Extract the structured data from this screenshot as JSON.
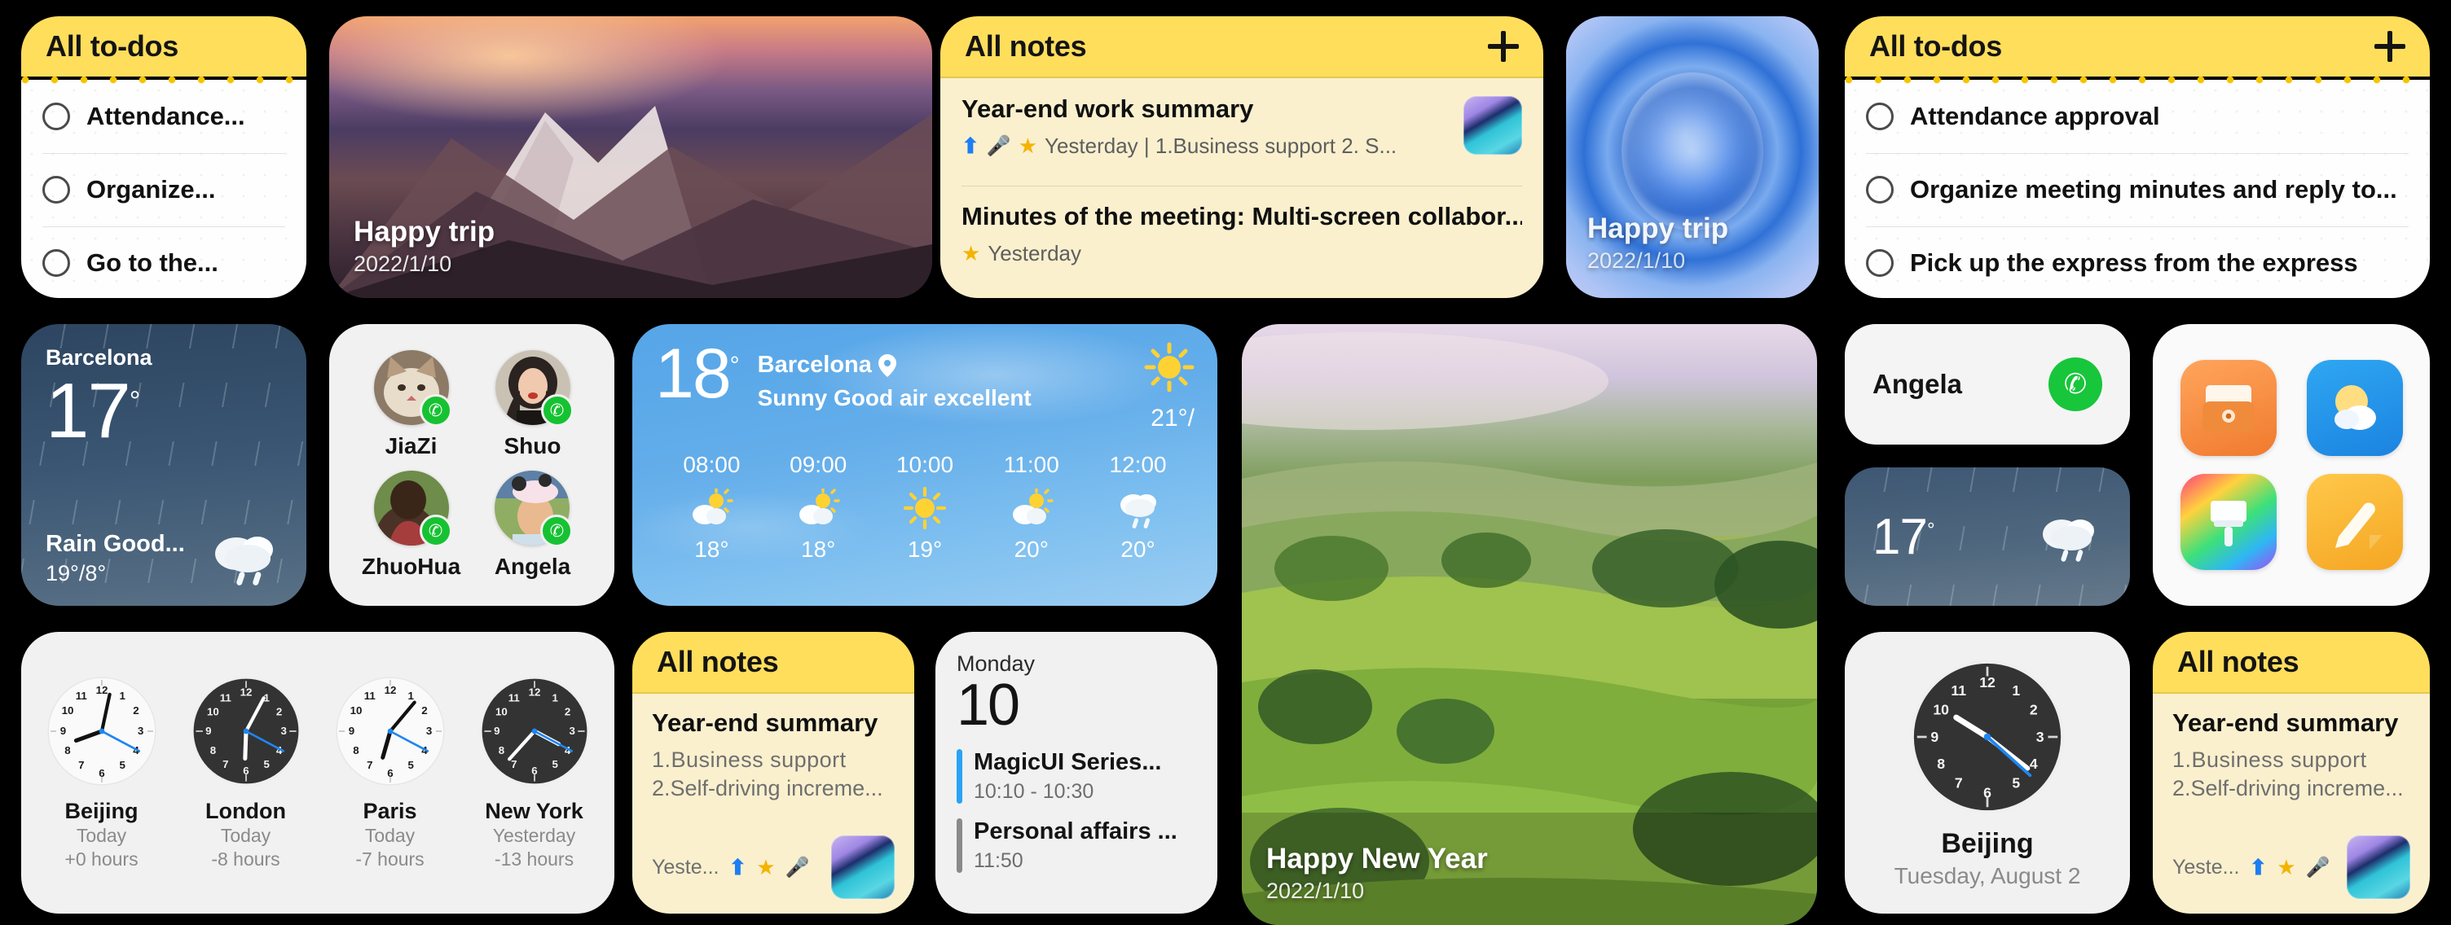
{
  "todo_small": {
    "title": "All to-dos",
    "items": [
      "Attendance...",
      "Organize...",
      "Go to the..."
    ]
  },
  "photo_trip": {
    "title": "Happy trip",
    "date": "2022/1/10"
  },
  "notes_wide": {
    "title": "All notes",
    "add_label": "+",
    "items": [
      {
        "title": "Year-end work summary",
        "meta": "Yesterday | 1.Business support  2. S...",
        "icons": [
          "up-icon",
          "mic-icon",
          "star-icon"
        ],
        "has_thumb": true
      },
      {
        "title": "Minutes of the meeting: Multi-screen collabor...",
        "meta": "Yesterday",
        "icons": [
          "star-icon"
        ],
        "has_thumb": false
      }
    ]
  },
  "photo_drop": {
    "title": "Happy trip",
    "date": "2022/1/10"
  },
  "todo_wide": {
    "title": "All to-dos",
    "add_label": "+",
    "items": [
      "Attendance approval",
      "Organize meeting minutes and reply to...",
      "Pick up the express from the express"
    ]
  },
  "weather_dark": {
    "city": "Barcelona",
    "temp": "17",
    "degree": "°",
    "condition": "Rain  Good...",
    "range": "19°/8°",
    "icon": "rain-cloud-icon"
  },
  "contacts": {
    "people": [
      {
        "name": "JiaZi",
        "avatar": "cat-avatar"
      },
      {
        "name": "Shuo",
        "avatar": "woman-avatar"
      },
      {
        "name": "ZhuoHua",
        "avatar": "woman-back-avatar"
      },
      {
        "name": "Angela",
        "avatar": "woman-hat-avatar"
      }
    ],
    "call_icon": "phone-icon"
  },
  "weather_blue": {
    "temp": "18",
    "degree": "°",
    "city": "Barcelona",
    "location_icon": "location-pin-icon",
    "condition": "Sunny  Good air excellent",
    "high": "21°/",
    "main_icon": "sun-icon",
    "hours": [
      {
        "time": "08:00",
        "icon": "partly-sunny-icon",
        "temp": "18°"
      },
      {
        "time": "09:00",
        "icon": "partly-sunny-icon",
        "temp": "18°"
      },
      {
        "time": "10:00",
        "icon": "sun-icon",
        "temp": "19°"
      },
      {
        "time": "11:00",
        "icon": "partly-sunny-icon",
        "temp": "20°"
      },
      {
        "time": "12:00",
        "icon": "rain-cloud-icon",
        "temp": "20°"
      }
    ]
  },
  "photo_newyear": {
    "title": "Happy New Year",
    "date": "2022/1/10"
  },
  "call_card": {
    "name": "Angela",
    "call_icon": "phone-icon"
  },
  "weather_small": {
    "temp": "17",
    "degree": "°",
    "icon": "rain-cloud-icon"
  },
  "app_grid": {
    "apps": [
      {
        "name": "Wallet",
        "icon": "wallet-icon"
      },
      {
        "name": "Weather",
        "icon": "weather-icon"
      },
      {
        "name": "Themes",
        "icon": "paintbrush-icon"
      },
      {
        "name": "Notes",
        "icon": "pencil-note-icon"
      }
    ]
  },
  "world_clocks": {
    "clocks": [
      {
        "city": "Beijing",
        "day": "Today",
        "offset": "+0 hours",
        "face": "light",
        "hour_deg": 250,
        "minute_deg": 12,
        "second_deg": 118
      },
      {
        "city": "London",
        "day": "Today",
        "offset": "-8 hours",
        "face": "dark",
        "hour_deg": 182,
        "minute_deg": 28,
        "second_deg": 118
      },
      {
        "city": "Paris",
        "day": "Today",
        "offset": "-7 hours",
        "face": "light",
        "hour_deg": 196,
        "minute_deg": 40,
        "second_deg": 118
      },
      {
        "city": "New York",
        "day": "Yesterday",
        "offset": "-13 hours",
        "face": "dark",
        "hour_deg": 118,
        "minute_deg": 222,
        "second_deg": 118
      }
    ]
  },
  "notes_small": {
    "title": "All notes",
    "note_title": "Year-end summary",
    "line1": "1.Business  support",
    "line2": "2.Self-driving increme...",
    "footer_time": "Yeste...",
    "footer_icons": [
      "up-icon",
      "star-icon",
      "mic-icon"
    ]
  },
  "calendar": {
    "weekday": "Monday",
    "day": "10",
    "events": [
      {
        "title": "MagicUI Series...",
        "time": "10:10 - 10:30",
        "color": "#2AA3F5"
      },
      {
        "title": "Personal affairs ...",
        "time": "11:50",
        "color": "#8A8A8A"
      }
    ]
  },
  "clock_big": {
    "city": "Beijing",
    "date": "Tuesday, August 2",
    "face": "dark",
    "hour_deg": 302,
    "minute_deg": 128,
    "second_deg": 132
  },
  "notes_small_right": {
    "title": "All notes",
    "note_title": "Year-end summary",
    "line1": "1.Business  support",
    "line2": "2.Self-driving increme...",
    "footer_time": "Yeste...",
    "footer_icons": [
      "up-icon",
      "star-icon",
      "mic-icon"
    ]
  },
  "colors": {
    "note_header": "#FFDE5C",
    "note_paper": "#FAF0CE",
    "call_green": "#16C232",
    "accent_blue": "#2AA3F5",
    "background": "#000000"
  }
}
